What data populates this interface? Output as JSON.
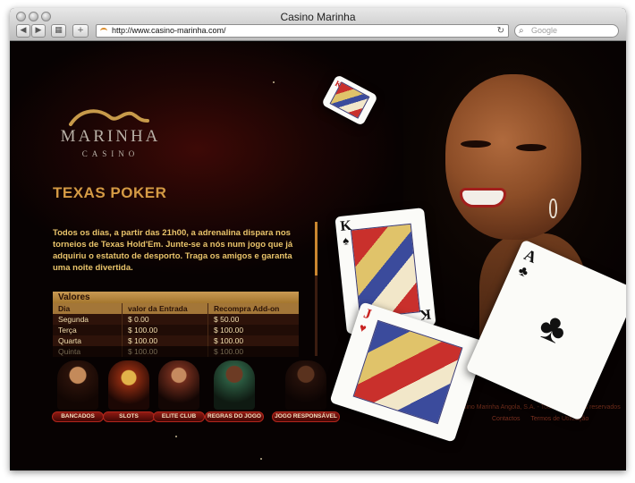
{
  "browser": {
    "title": "Casino Marinha",
    "url": "http://www.casino-marinha.com/",
    "search_placeholder": "Google",
    "back_glyph": "◀",
    "forward_glyph": "▶",
    "grid_glyph": "▦",
    "add_glyph": "+",
    "reload_glyph": "↻",
    "search_glyph": "⌕"
  },
  "logo": {
    "word": "MARINHA",
    "sub": "CASINO"
  },
  "page": {
    "heading": "TEXAS POKER",
    "intro": "Todos os dias, a partir das 21h00, a adrenalina dispara nos torneios de Texas Hold'Em. Junte-se a nós num jogo que já adquiriu o estatuto de desporto. Traga os amigos e garanta uma noite divertida."
  },
  "table": {
    "title": "Valores",
    "headers": [
      "Dia",
      "valor da Entrada",
      "Recompra Add-on"
    ],
    "rows": [
      [
        "Segunda",
        "$ 0.00",
        "$ 50.00"
      ],
      [
        "Terça",
        "$ 100.00",
        "$ 100.00"
      ],
      [
        "Quarta",
        "$ 100.00",
        "$ 100.00"
      ],
      [
        "Quinta",
        "$ 100.00",
        "$ 100.00"
      ]
    ]
  },
  "nav": [
    {
      "label": "BANCADOS"
    },
    {
      "label": "SLOTS"
    },
    {
      "label": "ELITE CLUB"
    },
    {
      "label": "REGRAS DO JOGO"
    },
    {
      "label": "JOGO RESPONSÁVEL"
    }
  ],
  "footer": {
    "copyright": "Casino Marinha Angola, S.A. - Todos os direitos reservados",
    "links": [
      "Contactos",
      "Termos de Utilização"
    ]
  },
  "cards": [
    {
      "rank": "K",
      "suit": "♠",
      "color": "black"
    },
    {
      "rank": "J",
      "suit": "♥",
      "color": "red"
    },
    {
      "rank": "A",
      "suit": "♣",
      "color": "black"
    },
    {
      "rank": "K",
      "suit": "♦",
      "color": "red"
    }
  ],
  "colors": {
    "accent_gold": "#d49a44",
    "text_gold": "#e9c46b",
    "button_red": "#8e1a12",
    "background": "#1c0504"
  }
}
